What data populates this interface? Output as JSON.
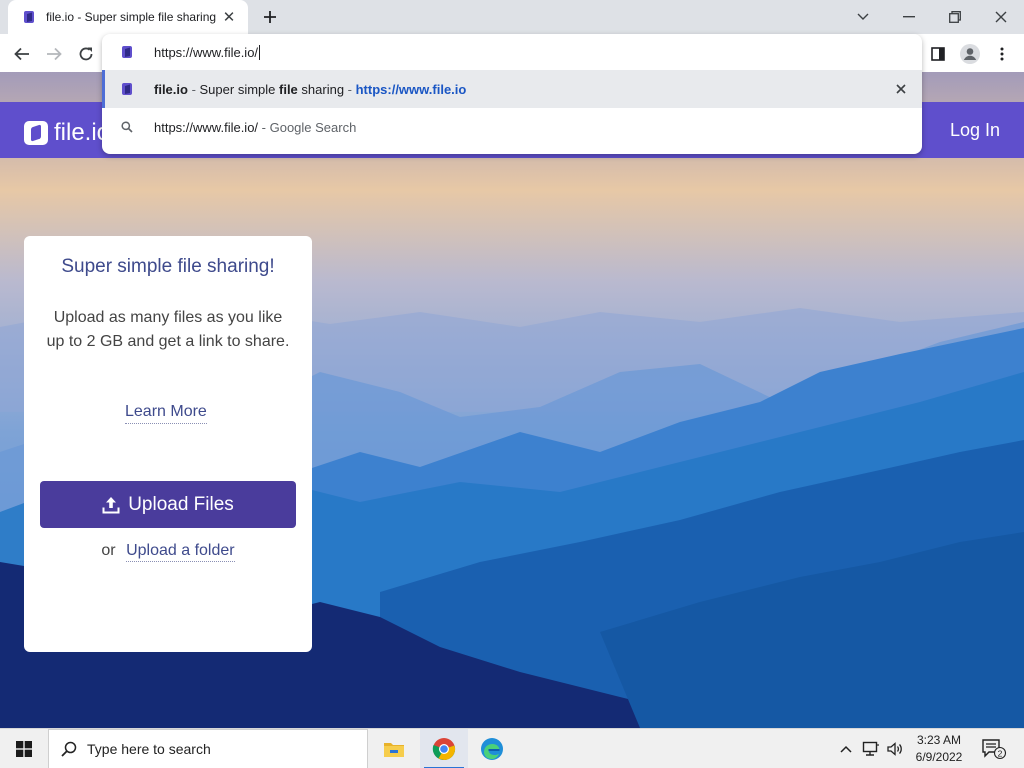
{
  "browser": {
    "tab_title": "file.io - Super simple file sharing",
    "tab_close": "✕",
    "address": "https://www.file.io/",
    "suggestions": [
      {
        "bold": "file.io",
        "sep": " - ",
        "pre": "Super simple ",
        "bold2": "file",
        "post": " sharing",
        "sep2": " - ",
        "link": "https://www.file.io"
      },
      {
        "text": "https://www.file.io/",
        "suffix": " - Google Search"
      }
    ]
  },
  "site": {
    "logo": "file.io",
    "login": "Log In",
    "brand_color": "#5f4fcc"
  },
  "card": {
    "heading": "Super simple file sharing!",
    "description": "Upload as many files as you like up to 2 GB and get a link to share.",
    "learn_more": "Learn More",
    "upload_button": "Upload Files",
    "or": "or",
    "upload_folder": "Upload a folder"
  },
  "taskbar": {
    "search_placeholder": "Type here to search",
    "time": "3:23 AM",
    "date": "6/9/2022",
    "notification_count": "2"
  }
}
